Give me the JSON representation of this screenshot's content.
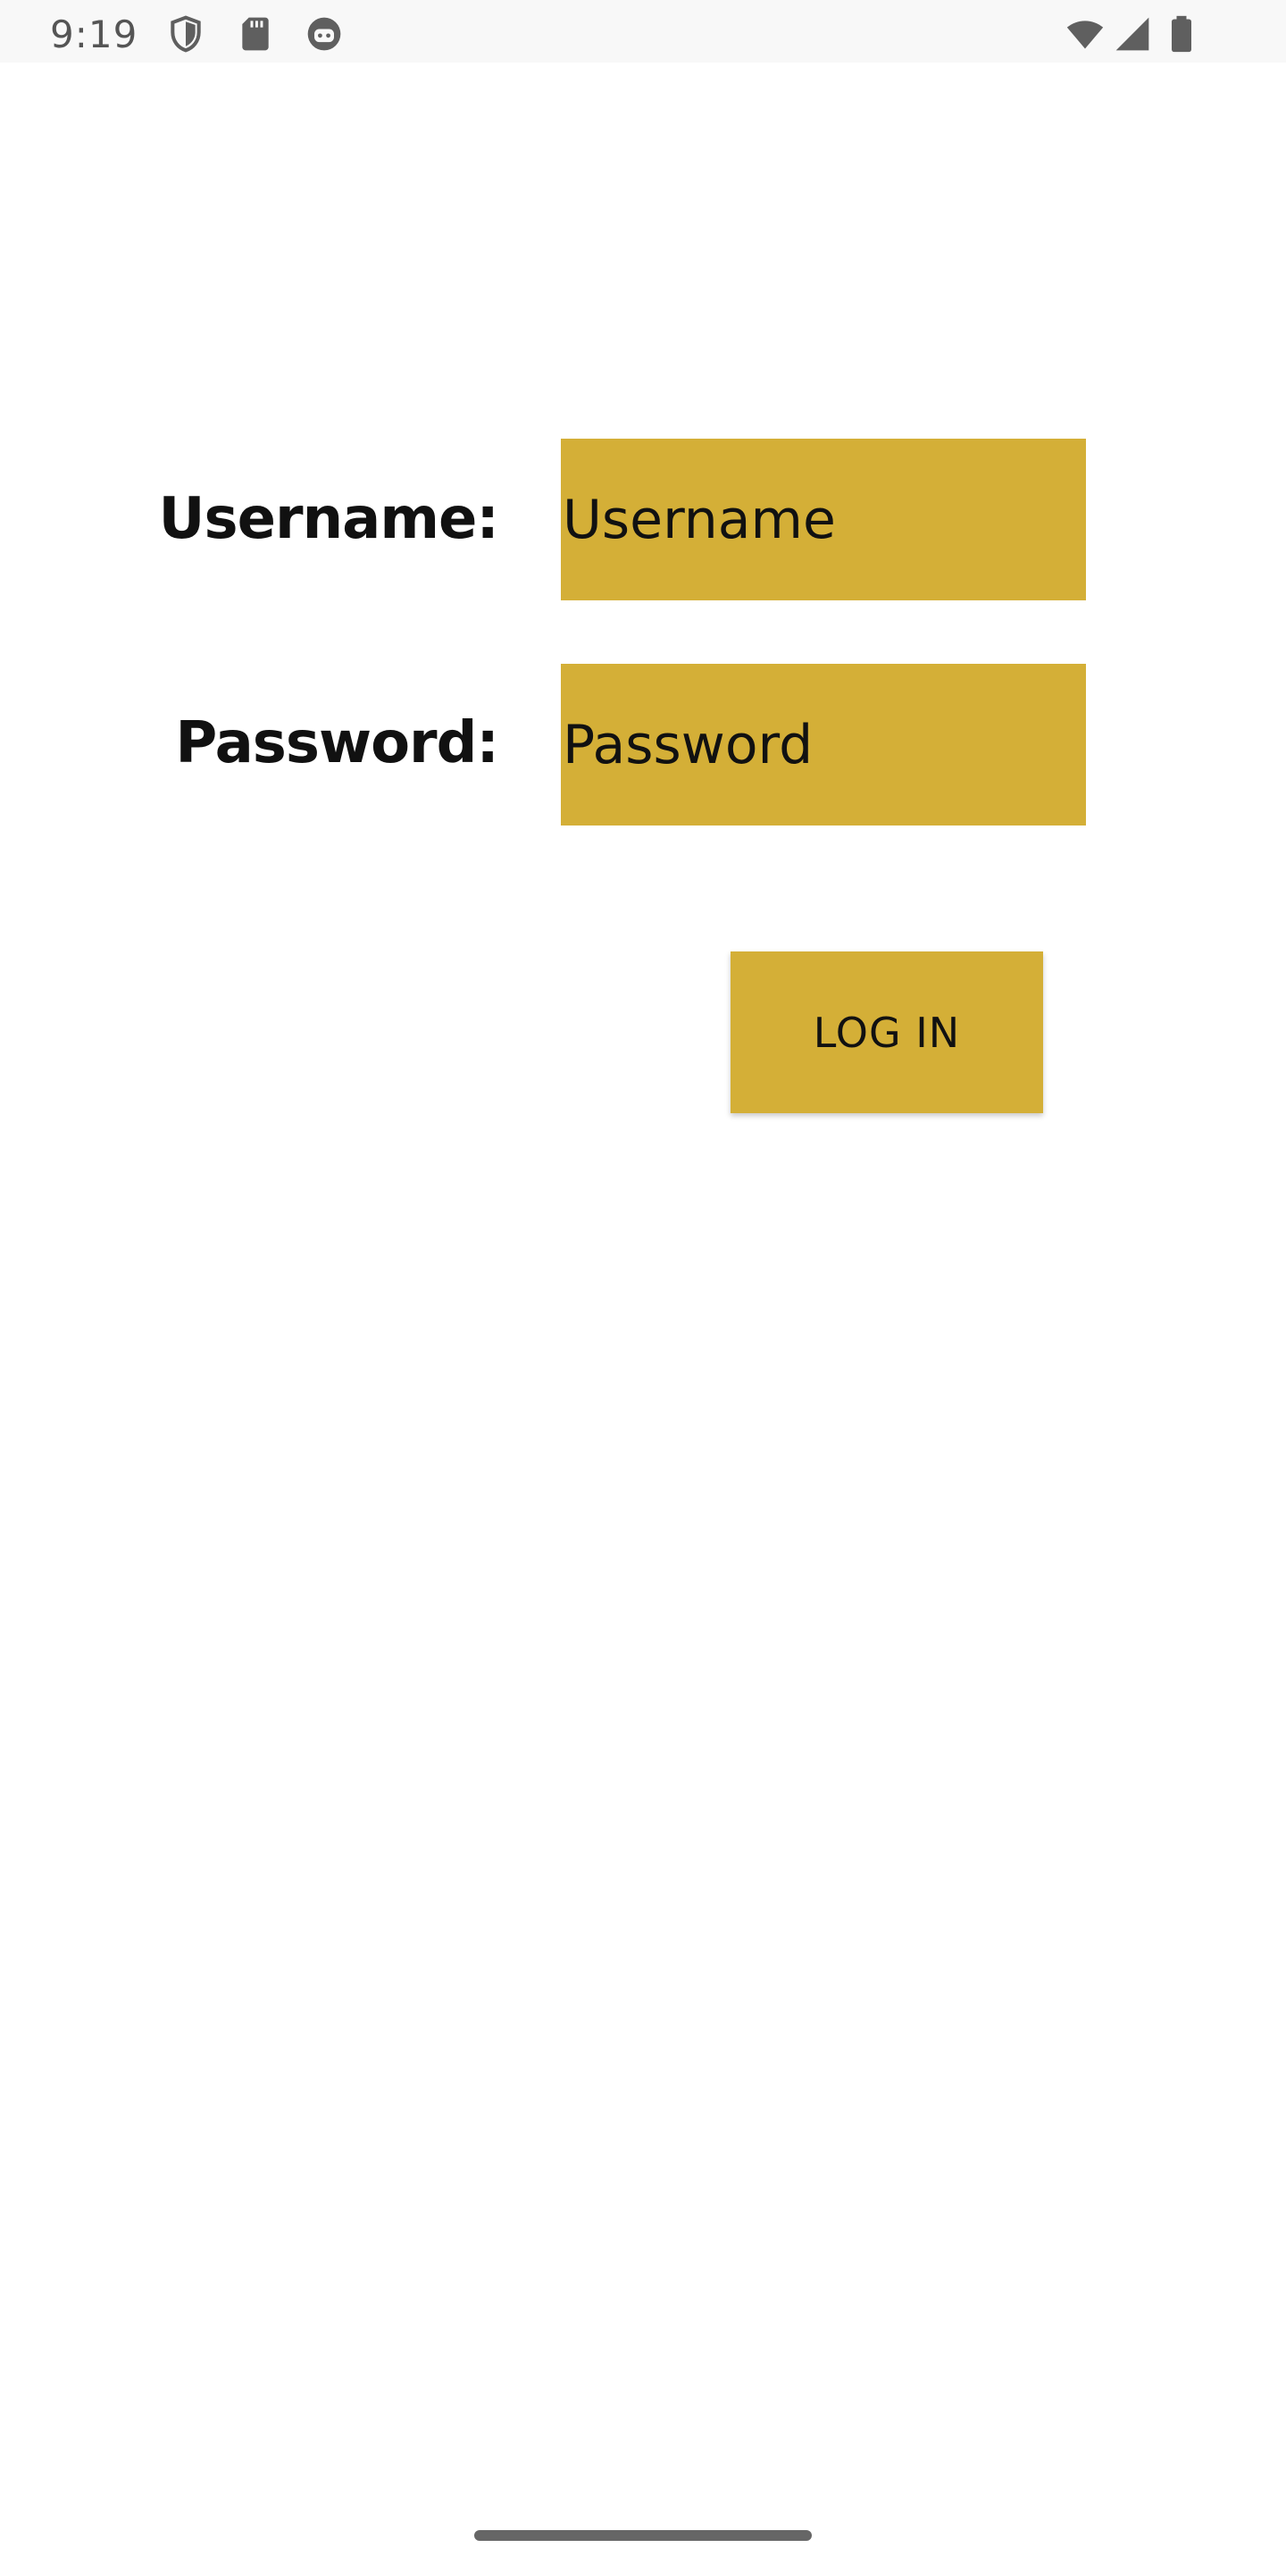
{
  "status_bar": {
    "time": "9:19",
    "left_icons": [
      "shield-icon",
      "sd-card-icon",
      "face-icon"
    ],
    "right_icons": [
      "wifi-icon",
      "cell-signal-icon",
      "battery-icon"
    ]
  },
  "login_form": {
    "username_label": "Username:",
    "username_placeholder": "Username",
    "username_value": "",
    "password_label": "Password:",
    "password_placeholder": "Password",
    "password_value": "",
    "login_button_label": "LOG IN"
  },
  "colors": {
    "accent": "#d4af37",
    "background": "#ffffff",
    "text": "#111111",
    "status_bar": "#f8f8f8"
  }
}
